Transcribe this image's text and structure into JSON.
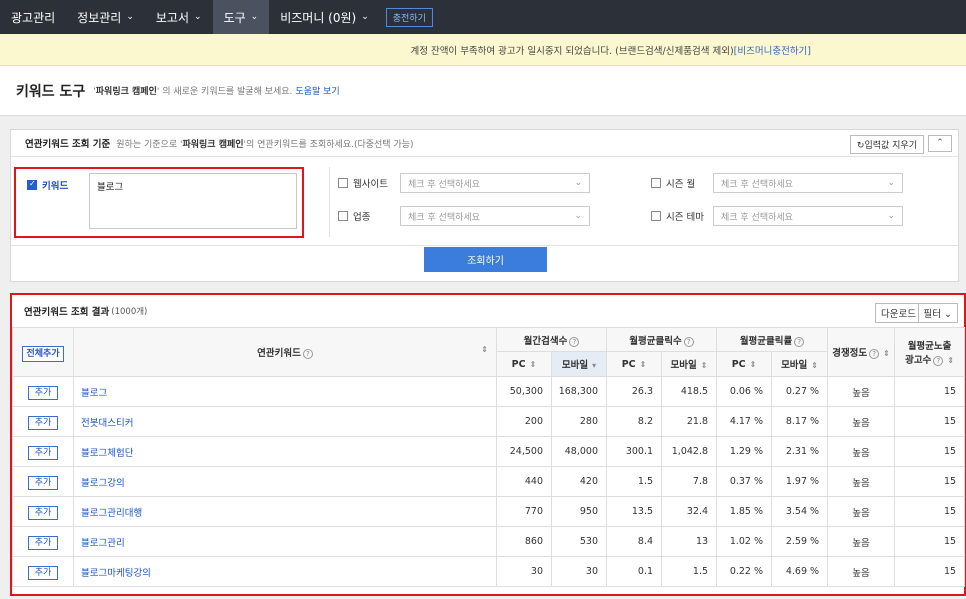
{
  "nav": {
    "items": [
      {
        "label": "광고관리",
        "chev": ""
      },
      {
        "label": "정보관리",
        "chev": "⌄"
      },
      {
        "label": "보고서",
        "chev": "⌄"
      },
      {
        "label": "도구",
        "chev": "⌄"
      },
      {
        "label": "비즈머니 (0원)",
        "chev": "⌄"
      }
    ],
    "charge_label": "충전하기"
  },
  "notice": {
    "text": "계정 잔액이 부족하여 광고가 일시중지 되었습니다. (브랜드검색/신제품검색 제외)",
    "link": "[비즈머니충전하기]"
  },
  "title": {
    "label": "키워드 도구",
    "desc_pre": "'",
    "desc_bold": "파워링크 캠페인",
    "desc_post": "' 의 새로운 키워드를 발굴해 보세요.",
    "help": "도움말 보기"
  },
  "query": {
    "title": "연관키워드 조회 기준",
    "desc_pre": "원하는 기준으로 '",
    "desc_bold": "파워링크 캠페인",
    "desc_post": "'의 연관키워드를 조회하세요.(다중선택 가능)",
    "reset": "↻입력값 지우기",
    "collapse": "⌃",
    "keyword_label": "키워드",
    "keyword_value": "블로그",
    "website_label": "웹사이트",
    "industry_label": "업종",
    "season_month_label": "시즌 월",
    "season_theme_label": "시즌 테마",
    "select_placeholder": "체크 후 선택하세요",
    "search_btn": "조회하기"
  },
  "results": {
    "title": "연관키워드 조회 결과",
    "count": "(1000개)",
    "download": "다운로드",
    "filter": "필터 ⌄",
    "all_add": "전체추가",
    "col_keyword": "연관키워드",
    "col_monthly_search": "월간검색수",
    "col_avg_clicks": "월평균클릭수",
    "col_avg_ctr": "월평균클릭률",
    "col_competition": "경쟁정도",
    "col_ad_count_1": "월평균노출",
    "col_ad_count_2": "광고수",
    "sub_pc": "PC",
    "sub_mobile": "모바일",
    "add_label": "추가",
    "rows": [
      {
        "keyword": "블로그",
        "search_pc": "50,300",
        "search_mo": "168,300",
        "click_pc": "26.3",
        "click_mo": "418.5",
        "ctr_pc": "0.06 %",
        "ctr_mo": "0.27 %",
        "comp": "높음",
        "ads": "15"
      },
      {
        "keyword": "전봇대스티커",
        "search_pc": "200",
        "search_mo": "280",
        "click_pc": "8.2",
        "click_mo": "21.8",
        "ctr_pc": "4.17 %",
        "ctr_mo": "8.17 %",
        "comp": "높음",
        "ads": "15"
      },
      {
        "keyword": "블로그체험단",
        "search_pc": "24,500",
        "search_mo": "48,000",
        "click_pc": "300.1",
        "click_mo": "1,042.8",
        "ctr_pc": "1.29 %",
        "ctr_mo": "2.31 %",
        "comp": "높음",
        "ads": "15"
      },
      {
        "keyword": "블로그강의",
        "search_pc": "440",
        "search_mo": "420",
        "click_pc": "1.5",
        "click_mo": "7.8",
        "ctr_pc": "0.37 %",
        "ctr_mo": "1.97 %",
        "comp": "높음",
        "ads": "15"
      },
      {
        "keyword": "블로그관리대행",
        "search_pc": "770",
        "search_mo": "950",
        "click_pc": "13.5",
        "click_mo": "32.4",
        "ctr_pc": "1.85 %",
        "ctr_mo": "3.54 %",
        "comp": "높음",
        "ads": "15"
      },
      {
        "keyword": "블로그관리",
        "search_pc": "860",
        "search_mo": "530",
        "click_pc": "8.4",
        "click_mo": "13",
        "ctr_pc": "1.02 %",
        "ctr_mo": "2.59 %",
        "comp": "높음",
        "ads": "15"
      },
      {
        "keyword": "블로그마케팅강의",
        "search_pc": "30",
        "search_mo": "30",
        "click_pc": "0.1",
        "click_mo": "1.5",
        "ctr_pc": "0.22 %",
        "ctr_mo": "4.69 %",
        "comp": "높음",
        "ads": "15"
      }
    ]
  }
}
